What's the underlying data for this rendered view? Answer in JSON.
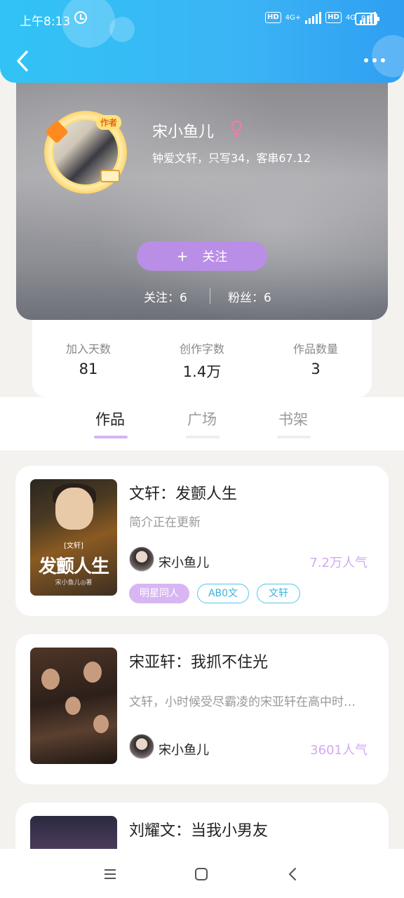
{
  "status_bar": {
    "time": "上午8:13",
    "hd1": "HD",
    "net1": "4G+",
    "hd2": "HD",
    "net2": "4G",
    "battery": "83"
  },
  "profile": {
    "author_tag": "作者",
    "name": "宋小鱼儿",
    "gender_symbol": "♀",
    "bio": "钟爱文轩，只写34，客串67.12",
    "follow_plus": "+",
    "follow_label": "关注",
    "following_text": "关注：6",
    "fans_text": "粉丝：6"
  },
  "stats": [
    {
      "label": "加入天数",
      "value": "81"
    },
    {
      "label": "创作字数",
      "value": "1.4万"
    },
    {
      "label": "作品数量",
      "value": "3"
    }
  ],
  "tabs": [
    {
      "label": "作品",
      "active": true
    },
    {
      "label": "广场",
      "active": false
    },
    {
      "label": "书架",
      "active": false
    }
  ],
  "works": [
    {
      "title": "文轩：发颤人生",
      "desc": "简介正在更新",
      "author": "宋小鱼儿",
      "popularity": "7.2万人气",
      "cover_title": "发颤人生",
      "cover_sub": "[文轩]",
      "cover_author": "宋小鱼儿◎著",
      "tags": [
        "明星同人",
        "AB0文",
        "文轩"
      ]
    },
    {
      "title": "宋亚轩：我抓不住光",
      "desc": "文轩，小时候受尽霸凌的宋亚轩在高中时…",
      "author": "宋小鱼儿",
      "popularity": "3601人气"
    },
    {
      "title": "刘耀文：当我小男友"
    }
  ],
  "colors": {
    "header_blue": "#31c3f5",
    "accent_purple": "#b98ee6",
    "tag_cyan": "#39b1dc",
    "popularity_purple": "#d2a9f0"
  },
  "icons": {
    "back": "back-icon",
    "more": "more-icon",
    "menu": "menu-icon",
    "home": "home-icon",
    "nav_back": "nav-back-icon"
  }
}
